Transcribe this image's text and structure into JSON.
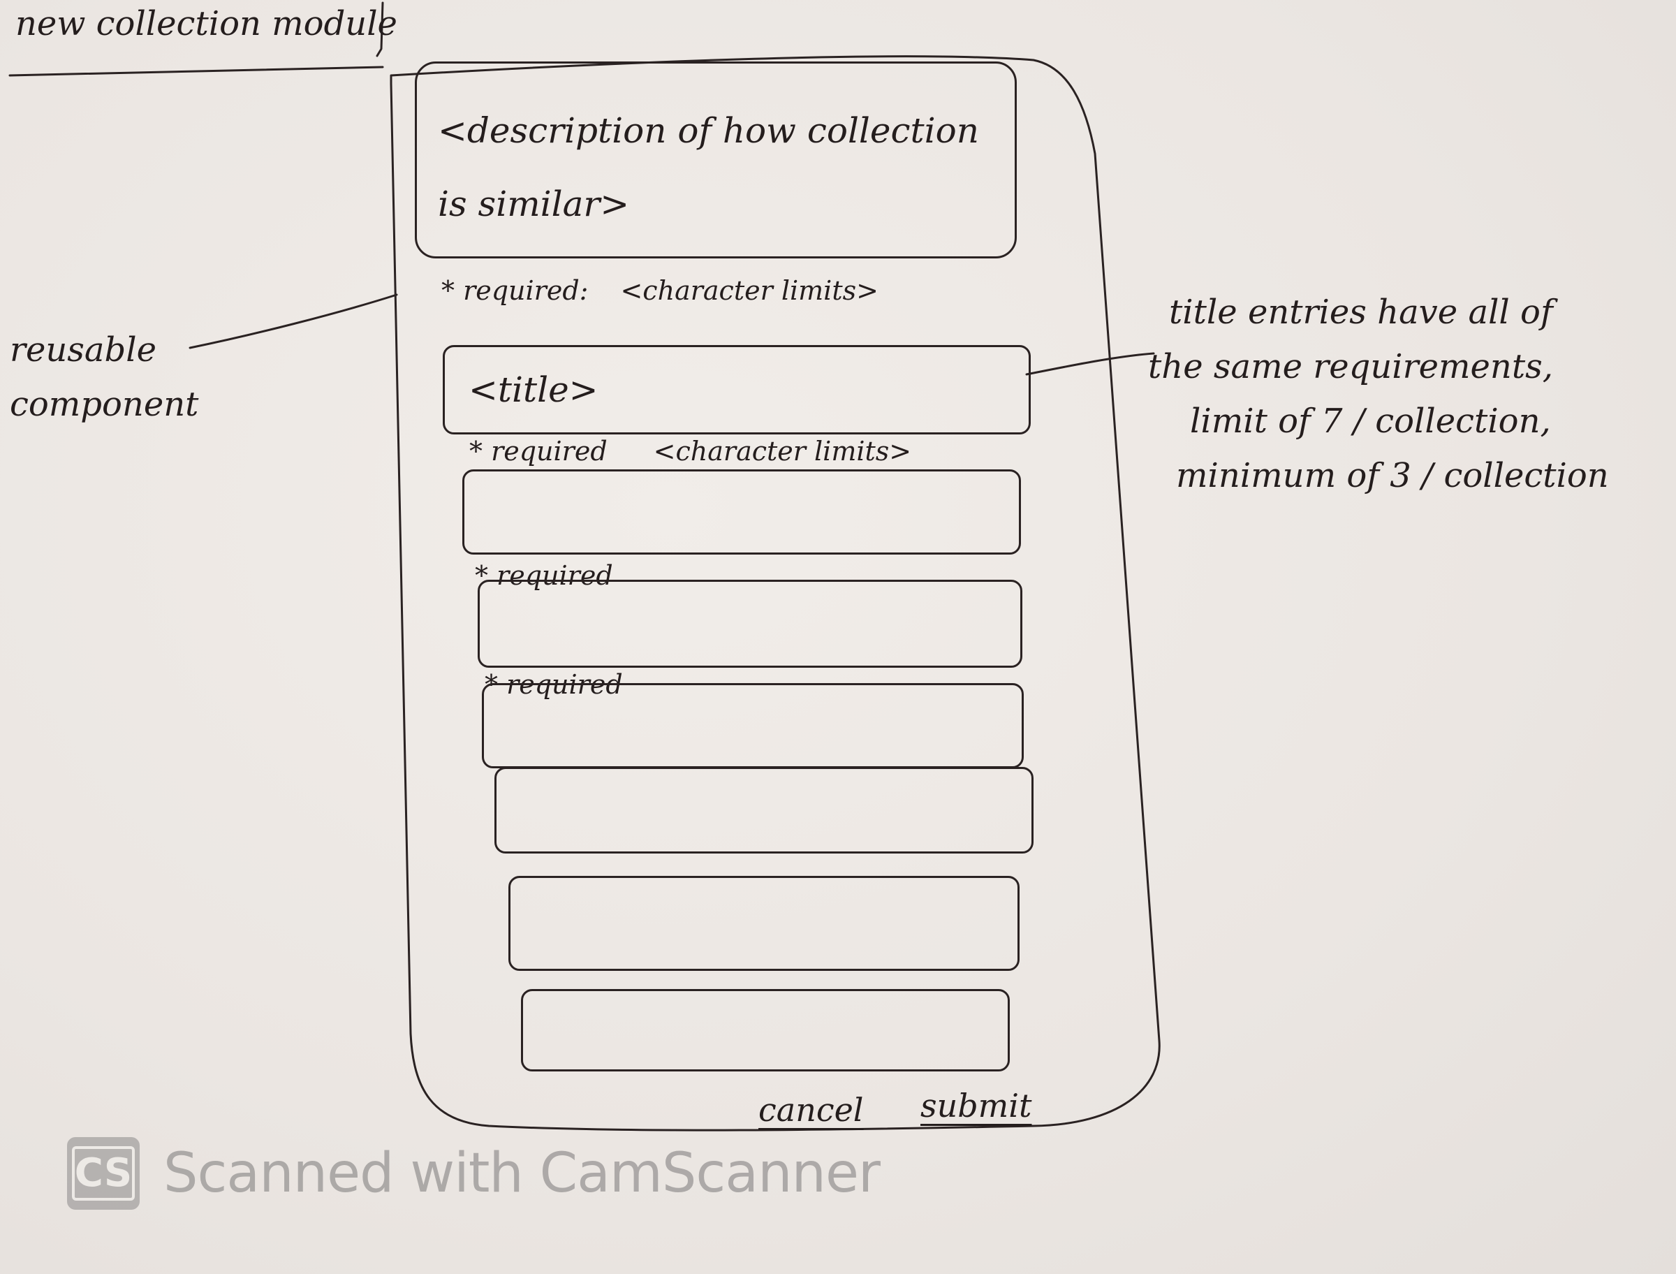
{
  "page_title": "new collection module",
  "annotations": {
    "reusable": "reusable component",
    "title_note": [
      "title entries have all of",
      "the same requirements,",
      "limit of 7 / collection,",
      "minimum of 3 / collection"
    ]
  },
  "description": {
    "placeholder": "<description of how collection is similar>",
    "required_label": "* required:",
    "limits_label": "<character limits>"
  },
  "titles": {
    "first_placeholder": "<title>",
    "required_label": "* required",
    "limits_label": "<character limits>",
    "count_shown": 7
  },
  "actions": {
    "cancel_label": "cancel",
    "submit_label": "submit"
  },
  "watermark": {
    "logo_text": "CS",
    "text": "Scanned with CamScanner"
  }
}
